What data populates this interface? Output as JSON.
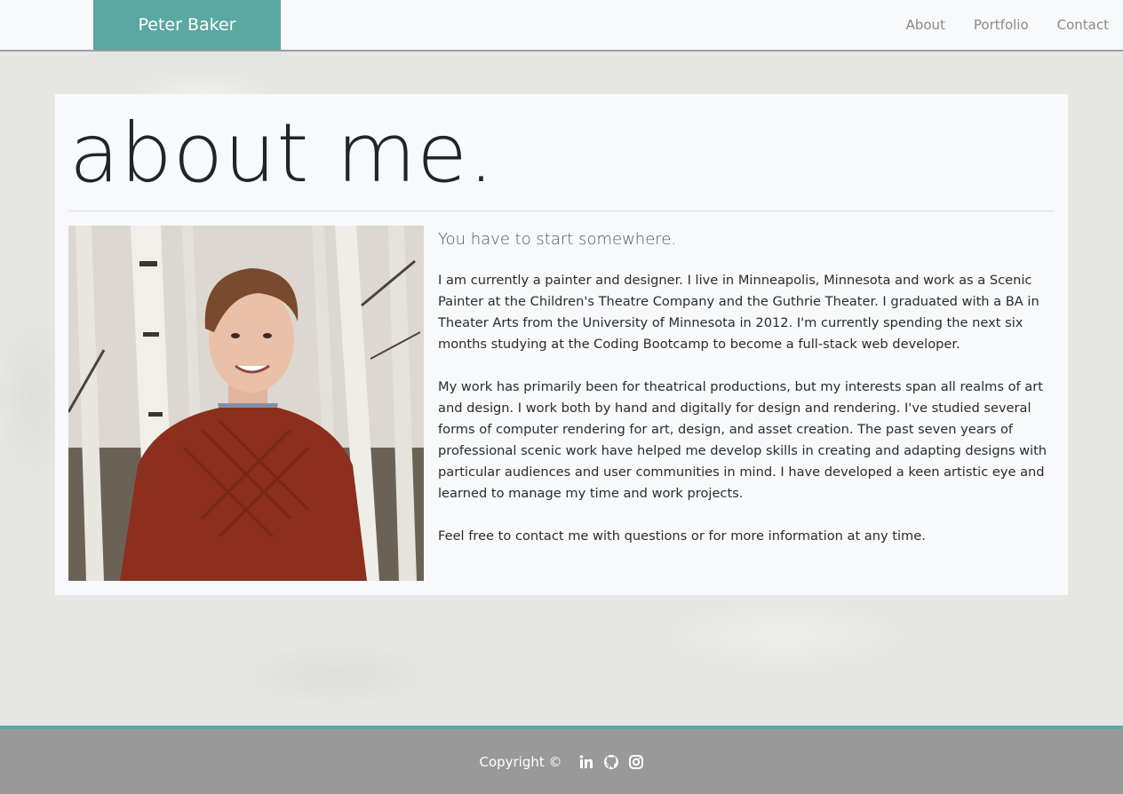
{
  "nav": {
    "brand": "Peter Baker",
    "links": [
      "About",
      "Portfolio",
      "Contact"
    ]
  },
  "main": {
    "title": "about me.",
    "subtitle": "You have to start somewhere.",
    "paragraphs": [
      "I am currently a painter and designer. I live in Minneapolis, Minnesota and work as a Scenic Painter at the Children's Theatre Company and the Guthrie Theater. I graduated with a BA in Theater Arts from the University of Minnesota in 2012. I'm currently spending the next six months studying at the Coding Bootcamp to become a full-stack web developer.",
      "My work has primarily been for theatrical productions, but my interests span all realms of art and design. I work both by hand and digitally for design and rendering. I've studied several forms of computer rendering for art, design, and asset creation. The past seven years of professional scenic work have helped me develop skills in creating and adapting designs with particular audiences and user communities in mind. I have developed a keen artistic eye and learned to manage my time and work projects.",
      "Feel free to contact me with questions or for more information at any time."
    ]
  },
  "footer": {
    "copyright": "Copyright ©",
    "icons": [
      "linkedin-icon",
      "github-icon",
      "instagram-icon"
    ]
  },
  "colors": {
    "accent": "#5aa8a1",
    "footer_bg": "#999999",
    "nav_bg": "#f8f9fa"
  }
}
